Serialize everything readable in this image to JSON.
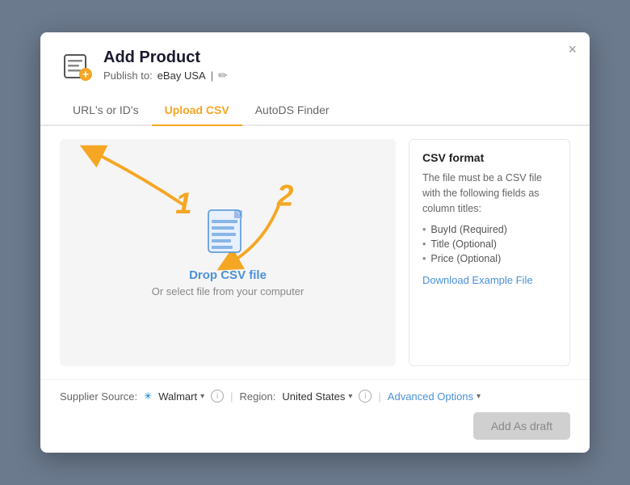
{
  "modal": {
    "title": "Add Product",
    "subtitle": {
      "prefix": "Publish to:",
      "value": "eBay USA",
      "separator": "|"
    },
    "close_label": "×"
  },
  "tabs": [
    {
      "id": "urls",
      "label": "URL's or ID's",
      "active": false
    },
    {
      "id": "upload_csv",
      "label": "Upload CSV",
      "active": true
    },
    {
      "id": "autods_finder",
      "label": "AutoDS Finder",
      "active": false
    }
  ],
  "upload_area": {
    "drop_label": "Drop CSV file",
    "drop_sub": "Or select file from your computer"
  },
  "csv_info": {
    "title": "CSV format",
    "description": "The file must be a CSV file with the following fields as column titles:",
    "fields": [
      "BuyId (Required)",
      "Title (Optional)",
      "Price (Optional)"
    ],
    "download_link": "Download Example File"
  },
  "footer": {
    "supplier_label": "Supplier Source:",
    "supplier_value": "Walmart",
    "region_label": "Region:",
    "region_value": "United States",
    "advanced_options": "Advanced Options"
  },
  "actions": {
    "add_draft_label": "Add As draft"
  },
  "annotations": {
    "one": "1",
    "two": "2"
  }
}
